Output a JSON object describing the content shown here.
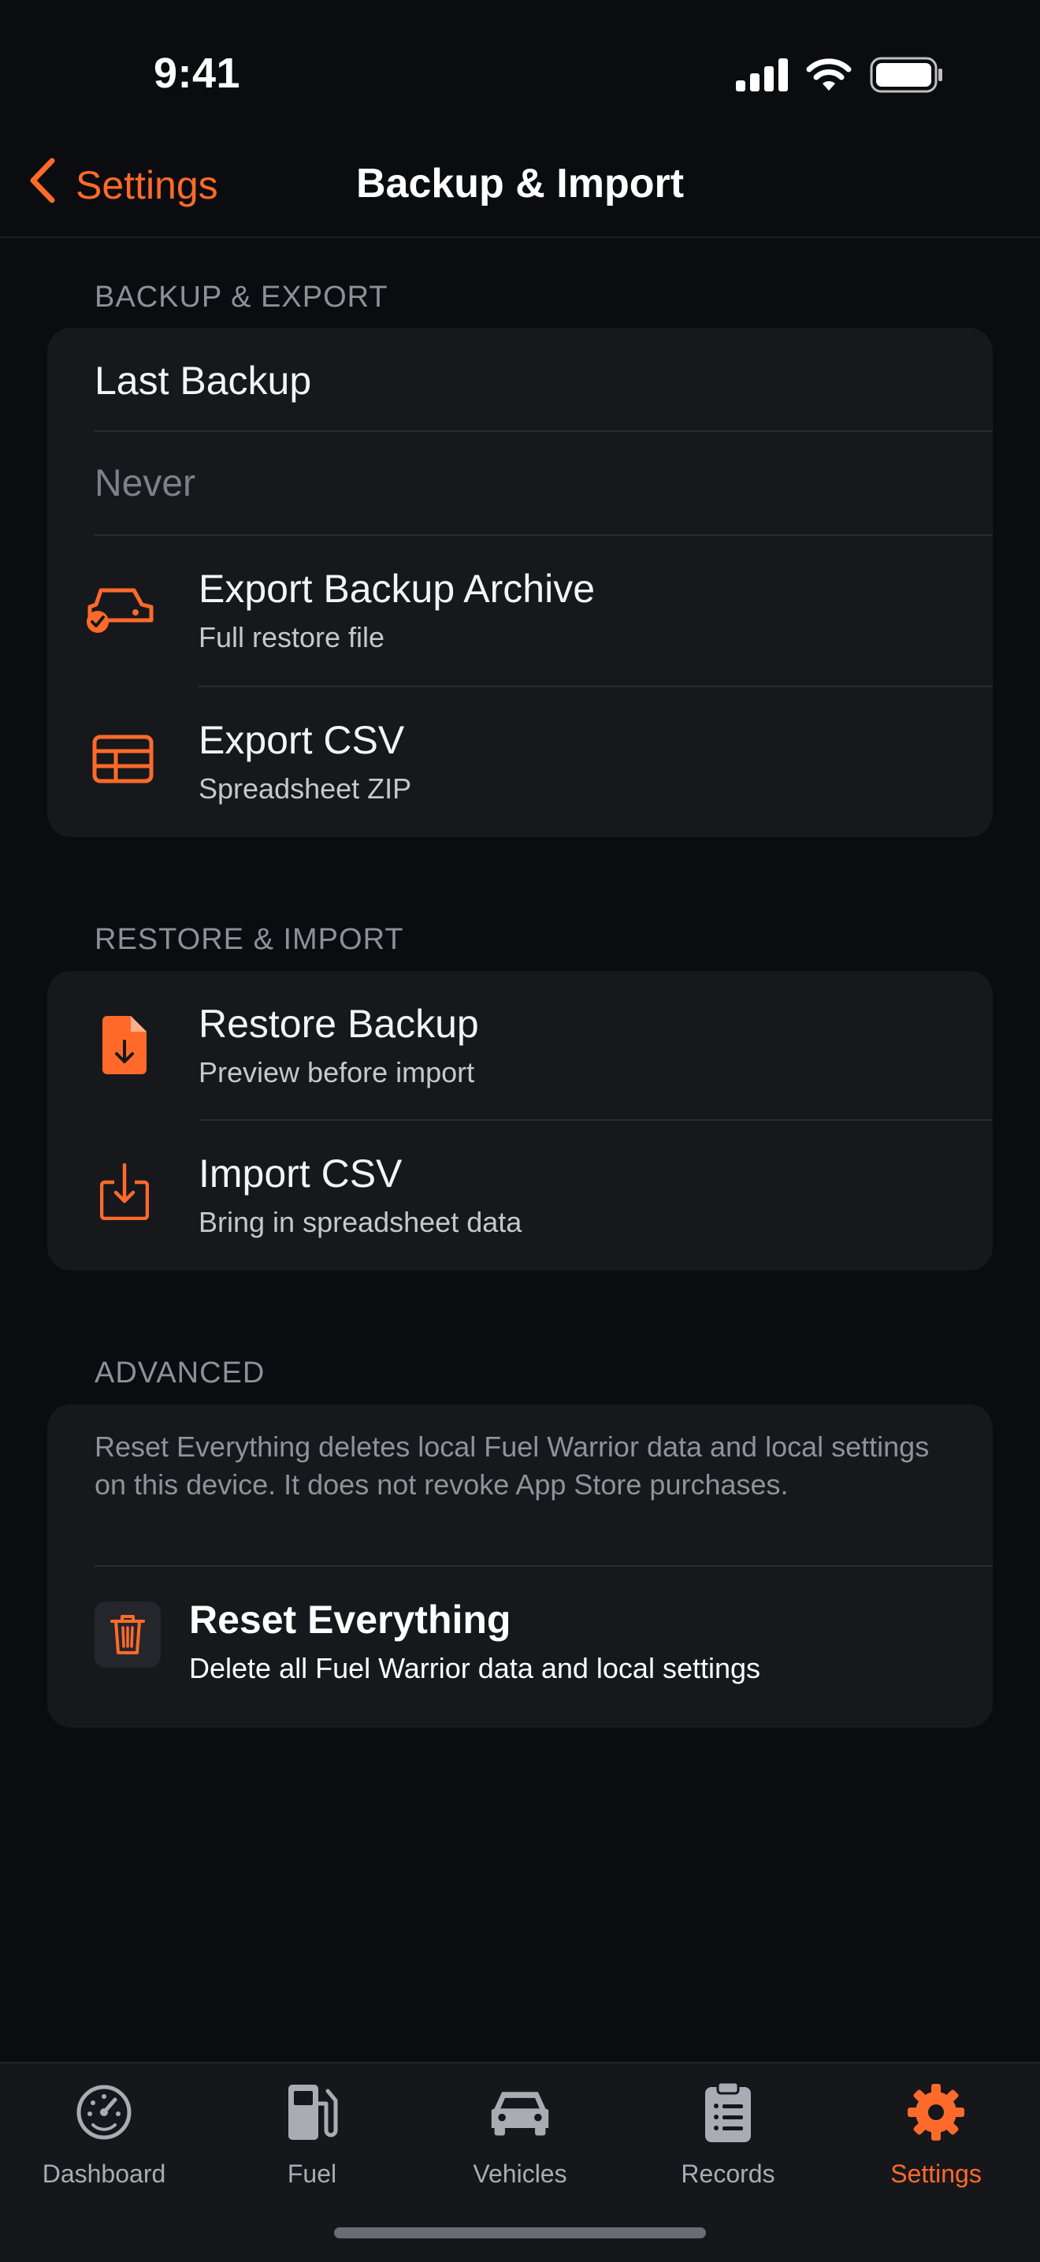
{
  "status_bar": {
    "time": "9:41"
  },
  "nav": {
    "back_label": "Settings",
    "title": "Backup & Import"
  },
  "sections": {
    "backup_export": {
      "header": "BACKUP & EXPORT",
      "last_backup_label": "Last Backup",
      "last_backup_value": "Never",
      "rows": [
        {
          "title": "Export Backup Archive",
          "subtitle": "Full restore file",
          "icon": "car-check-icon"
        },
        {
          "title": "Export CSV",
          "subtitle": "Spreadsheet ZIP",
          "icon": "table-icon"
        }
      ]
    },
    "restore_import": {
      "header": "RESTORE & IMPORT",
      "rows": [
        {
          "title": "Restore Backup",
          "subtitle": "Preview before import",
          "icon": "document-download-icon"
        },
        {
          "title": "Import CSV",
          "subtitle": "Bring in spreadsheet data",
          "icon": "tray-download-icon"
        }
      ]
    },
    "advanced": {
      "header": "ADVANCED",
      "description": "Reset Everything deletes local Fuel Warrior data and local settings on this device. It does not revoke App Store purchases.",
      "reset": {
        "title": "Reset Everything",
        "subtitle": "Delete all Fuel Warrior data and local settings",
        "icon": "trash-icon"
      }
    }
  },
  "tab_bar": {
    "tabs": [
      {
        "label": "Dashboard",
        "icon": "speedometer-icon",
        "active": false
      },
      {
        "label": "Fuel",
        "icon": "fuel-pump-icon",
        "active": false
      },
      {
        "label": "Vehicles",
        "icon": "car-icon",
        "active": false
      },
      {
        "label": "Records",
        "icon": "clipboard-icon",
        "active": false
      },
      {
        "label": "Settings",
        "icon": "gear-icon",
        "active": true
      }
    ]
  },
  "colors": {
    "accent": "#ff6a2a",
    "background": "#0b0c0f",
    "card": "#16181c",
    "muted_text": "#8d9097"
  }
}
